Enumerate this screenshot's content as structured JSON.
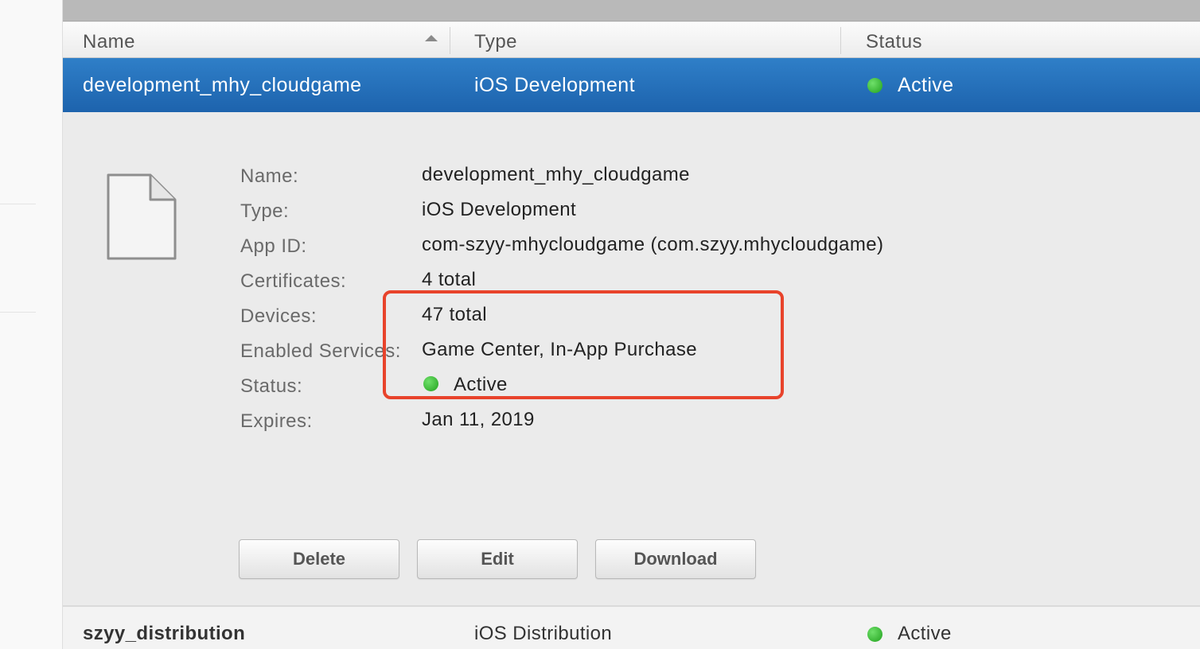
{
  "table": {
    "columns": {
      "name": "Name",
      "type": "Type",
      "status": "Status"
    },
    "selected_row": {
      "name": "development_mhy_cloudgame",
      "type": "iOS Development",
      "status": "Active"
    },
    "next_row": {
      "name": "szyy_distribution",
      "type": "iOS Distribution",
      "status": "Active"
    }
  },
  "detail": {
    "icon": "document-icon",
    "fields": [
      {
        "label": "Name:",
        "value": "development_mhy_cloudgame"
      },
      {
        "label": "Type:",
        "value": "iOS Development"
      },
      {
        "label": "App ID:",
        "value": "com-szyy-mhycloudgame (com.szyy.mhycloudgame)"
      },
      {
        "label": "Certificates:",
        "value": "4 total"
      },
      {
        "label": "Devices:",
        "value": "47 total"
      },
      {
        "label": "Enabled Services:",
        "value": "Game Center, In-App Purchase"
      },
      {
        "label": "Status:",
        "value": "Active"
      },
      {
        "label": "Expires:",
        "value": "Jan 11, 2019"
      }
    ],
    "buttons": {
      "delete": "Delete",
      "edit": "Edit",
      "download": "Download"
    }
  },
  "colors": {
    "selection": "#2170b9",
    "status_active": "#2fbf2a",
    "highlight_border": "#e8432b"
  }
}
